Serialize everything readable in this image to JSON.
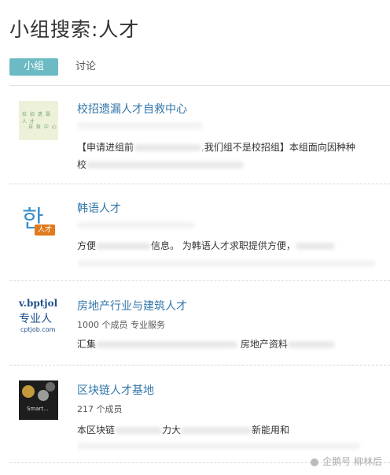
{
  "page": {
    "title": "小组搜索:人才"
  },
  "tabs": [
    {
      "label": "小组"
    },
    {
      "label": "讨论"
    }
  ],
  "results": [
    {
      "name": "校招遗漏人才自救中心",
      "thumb_line1": "校 招 遗 漏 人 才",
      "thumb_line2": "自 救 中 心",
      "desc_prefix": "【申请进组前",
      "desc_mid": "我们组不是校招组】",
      "desc_suffix": "本组面向因种种",
      "desc2": "校"
    },
    {
      "name": "韩语人才",
      "thumb_glyph": "한",
      "thumb_tag": "人才",
      "desc_prefix": "方便",
      "desc_mid": "信息。",
      "desc_suffix": "为韩语人才求职提供方便，"
    },
    {
      "name": "房地产行业与建筑人才",
      "thumb_a": "v.bptjol",
      "thumb_b": "专业人",
      "thumb_c": "cptjob.com",
      "meta_prefix": "1000",
      "meta_mid": "个成员",
      "meta_suffix": "专业服务",
      "desc_prefix": "汇集",
      "desc_suffix": "房地产资料"
    },
    {
      "name": "区块链人才基地",
      "thumb_text": "Smart...",
      "meta_prefix": "217",
      "meta_mid": "个成员",
      "desc_prefix": "本区块链",
      "desc_mid": "力大",
      "desc_suffix": "新能用和"
    }
  ],
  "watermark": {
    "source": "企鹅号",
    "author": "柳林后"
  }
}
